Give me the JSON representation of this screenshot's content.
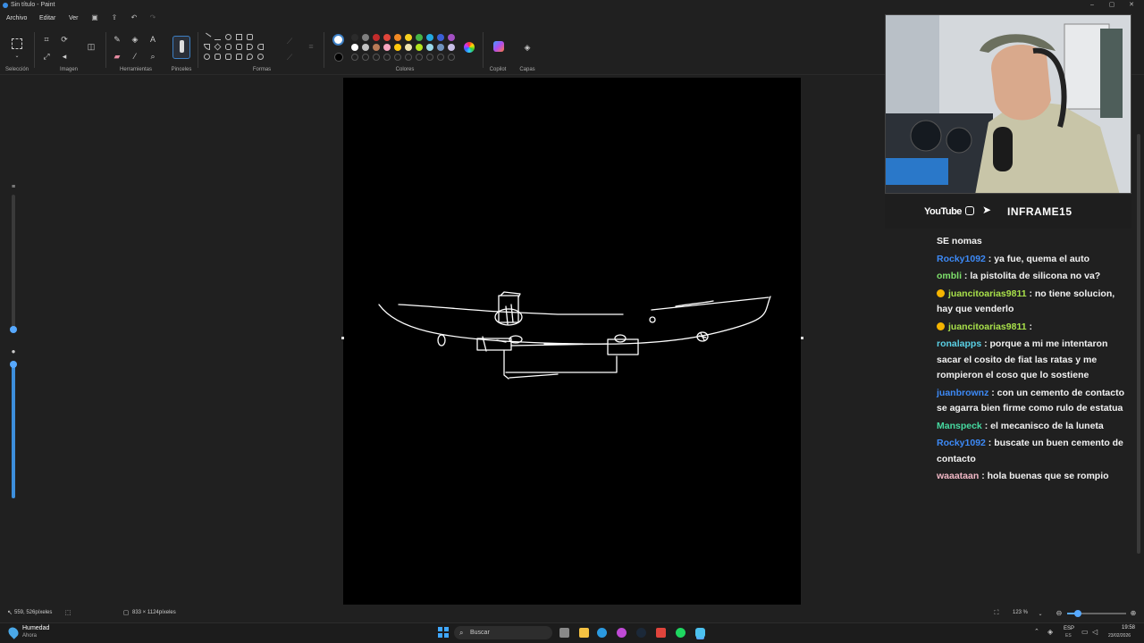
{
  "window": {
    "title": "Sin título - Paint"
  },
  "menu": {
    "file": "Archivo",
    "edit": "Editar",
    "view": "Ver"
  },
  "ribbon": {
    "groups": {
      "selection": "Selección",
      "image": "Imagen",
      "tools": "Herramientas",
      "brushes": "Pinceles",
      "shapes": "Formas",
      "colors": "Colores",
      "copilot": "Copilot",
      "layers": "Capas"
    },
    "palette_row1": [
      "#2b2b2b",
      "#7f7f7f",
      "#c22b2b",
      "#e0453b",
      "#f08a24",
      "#f5cf1f",
      "#46b446",
      "#23a9e1",
      "#3a5fd6",
      "#a34fc3"
    ],
    "palette_row2": [
      "#ffffff",
      "#c3c3c3",
      "#b97a57",
      "#f6a6c0",
      "#ffc90e",
      "#efe4b0",
      "#b5e61d",
      "#99d9ea",
      "#7092be",
      "#c8bfe7"
    ],
    "primary_color": "#ffffff",
    "secondary_color": "#000000"
  },
  "status": {
    "cursor_position": "559, 526píxeles",
    "canvas_size": "833 × 1124píxeles",
    "zoom": "123 %"
  },
  "taskbar": {
    "weather_title": "Humedad",
    "weather_sub": "Ahora",
    "search_placeholder": "Buscar",
    "lang": "ESP",
    "lang_sub": "ES",
    "time": "19:58",
    "date": "23/02/2026"
  },
  "stream": {
    "social_youtube": "YouTube",
    "channel": "INFRAME15",
    "chat": [
      {
        "user": "",
        "text": "SE nomas",
        "color": "#f2f2f2"
      },
      {
        "user": "Rocky1092",
        "text": " : ya fue, quema el auto",
        "color": "#3d8af7"
      },
      {
        "user": "ombli",
        "text": " : la pistolita de silicona no va?",
        "color": "#7ee06b"
      },
      {
        "user": "juancitoarias9811",
        "text": " : no tiene solucion, hay que venderlo",
        "color": "#a8e04a",
        "badge": true
      },
      {
        "user": "juancitoarias9811",
        "text": " : ",
        "color": "#a8e04a",
        "badge": true
      },
      {
        "user": "ronalapps",
        "text": " : porque a mi me intentaron sacar el cosito de fiat las ratas y me rompieron el coso que lo sostiene",
        "color": "#5ad1e6"
      },
      {
        "user": "juanbrownz",
        "text": " : con un cemento de contacto se agarra bien firme como rulo de estatua",
        "color": "#3d8af7"
      },
      {
        "user": "Manspeck",
        "text": " : el mecanisco de la luneta",
        "color": "#46d9a0"
      },
      {
        "user": "Rocky1092",
        "text": " : buscate un buen cemento de contacto",
        "color": "#3d8af7"
      },
      {
        "user": "waaataan",
        "text": " : hola buenas que se rompio",
        "color": "#f2b8c6"
      }
    ]
  }
}
